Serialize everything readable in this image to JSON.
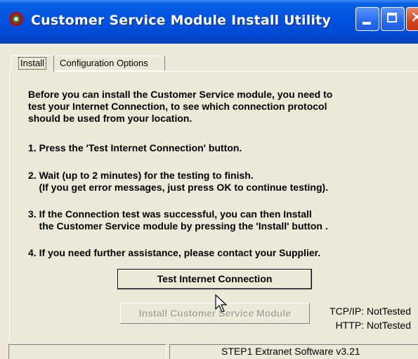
{
  "window": {
    "title": "Customer Service Module Install Utility",
    "app_icon": "app-logo-icon",
    "controls": {
      "minimize": "minimize-icon",
      "maximize": "maximize-icon",
      "close": "close-icon"
    }
  },
  "tabs": [
    {
      "label": "Install",
      "selected": true
    },
    {
      "label": "Configuration Options",
      "selected": false
    }
  ],
  "content": {
    "intro_1": "Before you can install the Customer Service module, you need to",
    "intro_2": "test your Internet Connection, to see which connection protocol",
    "intro_3": "should be used from your location.",
    "step1": "1. Press the 'Test Internet Connection' button.",
    "step2_1": "2. Wait (up to 2 minutes) for the testing to finish.",
    "step2_2": "    (If you get error messages, just press OK to continue testing).",
    "step3_1": "3. If the Connection test was successful, you can then Install",
    "step3_2": "    the Customer Service module by pressing the 'Install' button .",
    "step4": "4. If you need further assistance, please contact your Supplier."
  },
  "buttons": {
    "test": "Test Internet Connection",
    "install": "Install Customer Service Module",
    "install_enabled": false
  },
  "status": {
    "tcpip": "TCP/IP: NotTested",
    "http": "HTTP: NotTested"
  },
  "statusbar": {
    "left": "",
    "right": "STEP1 Extranet Software v3.21"
  },
  "colors": {
    "titlebar": "#0054e3",
    "face": "#ece9d8",
    "close_button": "#d2471f",
    "disabled_text": "#aca899"
  }
}
